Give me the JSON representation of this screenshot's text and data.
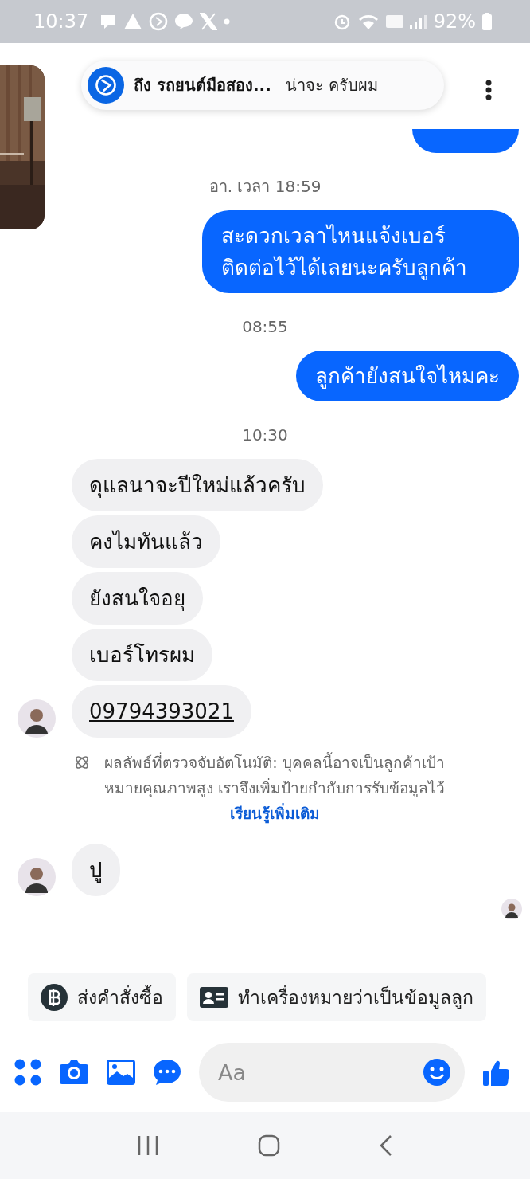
{
  "status_bar": {
    "time": "10:37",
    "battery": "92%"
  },
  "banner": {
    "title": "ถึง รถยนต์มือสอง...",
    "subtitle": "น่าจะ ครับผม"
  },
  "messages": [
    {
      "kind": "timestamp",
      "text": "อา. เวลา 18:59"
    },
    {
      "kind": "outgoing",
      "text": "สะดวกเวลาไหนแจ้งเบอร์ ติดต่อไว้ได้เลยนะครับลูกค้า"
    },
    {
      "kind": "timestamp",
      "text": "08:55"
    },
    {
      "kind": "outgoing",
      "text": "ลูกค้ายังสนใจไหมคะ"
    },
    {
      "kind": "timestamp",
      "text": "10:30"
    },
    {
      "kind": "incoming",
      "text": "ดุแลนาจะปีใหม่แล้วครับ",
      "avatar": false,
      "link": false
    },
    {
      "kind": "incoming",
      "text": "คงไมทันแล้ว",
      "avatar": false,
      "link": false
    },
    {
      "kind": "incoming",
      "text": "ยังสนใจอยุ",
      "avatar": false,
      "link": false
    },
    {
      "kind": "incoming",
      "text": "เบอร์โทรผม",
      "avatar": false,
      "link": false
    },
    {
      "kind": "incoming",
      "text": "09794393021",
      "avatar": true,
      "link": true
    },
    {
      "kind": "notice",
      "text": "ผลลัพธ์ที่ตรวจจับอัตโนมัติ: บุคคลนี้อาจเป็นลูกค้าเป้าหมายคุณภาพสูง เราจึงเพิ่มป้ายกำกับการรับข้อมูลไว้",
      "link": "เรียนรู้เพิ่มเติม"
    },
    {
      "kind": "incoming",
      "text": "ปู",
      "avatar": true,
      "link": false
    }
  ],
  "quick_replies": [
    {
      "kind": "order",
      "label": "ส่งคำสั่งซื้อ"
    },
    {
      "kind": "lead",
      "label": "ทำเครื่องหมายว่าเป็นข้อมูลลูก"
    }
  ],
  "composer": {
    "placeholder": "Aa"
  }
}
